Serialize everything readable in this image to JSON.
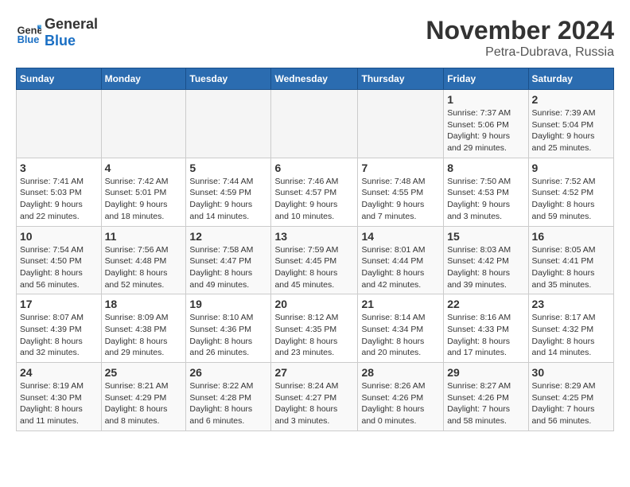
{
  "logo": {
    "line1": "General",
    "line2": "Blue"
  },
  "title": "November 2024",
  "subtitle": "Petra-Dubrava, Russia",
  "days_of_week": [
    "Sunday",
    "Monday",
    "Tuesday",
    "Wednesday",
    "Thursday",
    "Friday",
    "Saturday"
  ],
  "weeks": [
    [
      {
        "day": "",
        "info": ""
      },
      {
        "day": "",
        "info": ""
      },
      {
        "day": "",
        "info": ""
      },
      {
        "day": "",
        "info": ""
      },
      {
        "day": "",
        "info": ""
      },
      {
        "day": "1",
        "info": "Sunrise: 7:37 AM\nSunset: 5:06 PM\nDaylight: 9 hours\nand 29 minutes."
      },
      {
        "day": "2",
        "info": "Sunrise: 7:39 AM\nSunset: 5:04 PM\nDaylight: 9 hours\nand 25 minutes."
      }
    ],
    [
      {
        "day": "3",
        "info": "Sunrise: 7:41 AM\nSunset: 5:03 PM\nDaylight: 9 hours\nand 22 minutes."
      },
      {
        "day": "4",
        "info": "Sunrise: 7:42 AM\nSunset: 5:01 PM\nDaylight: 9 hours\nand 18 minutes."
      },
      {
        "day": "5",
        "info": "Sunrise: 7:44 AM\nSunset: 4:59 PM\nDaylight: 9 hours\nand 14 minutes."
      },
      {
        "day": "6",
        "info": "Sunrise: 7:46 AM\nSunset: 4:57 PM\nDaylight: 9 hours\nand 10 minutes."
      },
      {
        "day": "7",
        "info": "Sunrise: 7:48 AM\nSunset: 4:55 PM\nDaylight: 9 hours\nand 7 minutes."
      },
      {
        "day": "8",
        "info": "Sunrise: 7:50 AM\nSunset: 4:53 PM\nDaylight: 9 hours\nand 3 minutes."
      },
      {
        "day": "9",
        "info": "Sunrise: 7:52 AM\nSunset: 4:52 PM\nDaylight: 8 hours\nand 59 minutes."
      }
    ],
    [
      {
        "day": "10",
        "info": "Sunrise: 7:54 AM\nSunset: 4:50 PM\nDaylight: 8 hours\nand 56 minutes."
      },
      {
        "day": "11",
        "info": "Sunrise: 7:56 AM\nSunset: 4:48 PM\nDaylight: 8 hours\nand 52 minutes."
      },
      {
        "day": "12",
        "info": "Sunrise: 7:58 AM\nSunset: 4:47 PM\nDaylight: 8 hours\nand 49 minutes."
      },
      {
        "day": "13",
        "info": "Sunrise: 7:59 AM\nSunset: 4:45 PM\nDaylight: 8 hours\nand 45 minutes."
      },
      {
        "day": "14",
        "info": "Sunrise: 8:01 AM\nSunset: 4:44 PM\nDaylight: 8 hours\nand 42 minutes."
      },
      {
        "day": "15",
        "info": "Sunrise: 8:03 AM\nSunset: 4:42 PM\nDaylight: 8 hours\nand 39 minutes."
      },
      {
        "day": "16",
        "info": "Sunrise: 8:05 AM\nSunset: 4:41 PM\nDaylight: 8 hours\nand 35 minutes."
      }
    ],
    [
      {
        "day": "17",
        "info": "Sunrise: 8:07 AM\nSunset: 4:39 PM\nDaylight: 8 hours\nand 32 minutes."
      },
      {
        "day": "18",
        "info": "Sunrise: 8:09 AM\nSunset: 4:38 PM\nDaylight: 8 hours\nand 29 minutes."
      },
      {
        "day": "19",
        "info": "Sunrise: 8:10 AM\nSunset: 4:36 PM\nDaylight: 8 hours\nand 26 minutes."
      },
      {
        "day": "20",
        "info": "Sunrise: 8:12 AM\nSunset: 4:35 PM\nDaylight: 8 hours\nand 23 minutes."
      },
      {
        "day": "21",
        "info": "Sunrise: 8:14 AM\nSunset: 4:34 PM\nDaylight: 8 hours\nand 20 minutes."
      },
      {
        "day": "22",
        "info": "Sunrise: 8:16 AM\nSunset: 4:33 PM\nDaylight: 8 hours\nand 17 minutes."
      },
      {
        "day": "23",
        "info": "Sunrise: 8:17 AM\nSunset: 4:32 PM\nDaylight: 8 hours\nand 14 minutes."
      }
    ],
    [
      {
        "day": "24",
        "info": "Sunrise: 8:19 AM\nSunset: 4:30 PM\nDaylight: 8 hours\nand 11 minutes."
      },
      {
        "day": "25",
        "info": "Sunrise: 8:21 AM\nSunset: 4:29 PM\nDaylight: 8 hours\nand 8 minutes."
      },
      {
        "day": "26",
        "info": "Sunrise: 8:22 AM\nSunset: 4:28 PM\nDaylight: 8 hours\nand 6 minutes."
      },
      {
        "day": "27",
        "info": "Sunrise: 8:24 AM\nSunset: 4:27 PM\nDaylight: 8 hours\nand 3 minutes."
      },
      {
        "day": "28",
        "info": "Sunrise: 8:26 AM\nSunset: 4:26 PM\nDaylight: 8 hours\nand 0 minutes."
      },
      {
        "day": "29",
        "info": "Sunrise: 8:27 AM\nSunset: 4:26 PM\nDaylight: 7 hours\nand 58 minutes."
      },
      {
        "day": "30",
        "info": "Sunrise: 8:29 AM\nSunset: 4:25 PM\nDaylight: 7 hours\nand 56 minutes."
      }
    ]
  ]
}
